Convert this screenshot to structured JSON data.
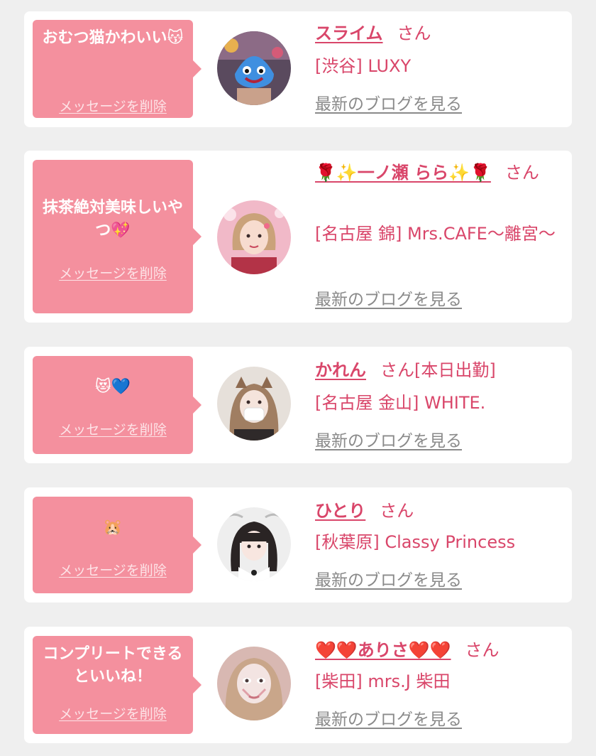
{
  "colors": {
    "page_bg": "#efefef",
    "card_bg": "#ffffff",
    "bubble_bg": "#f4909e",
    "accent_text": "#d9466a",
    "link_gray": "#8a8a8a"
  },
  "messages": [
    {
      "message": "おむつ猫かわいい😽",
      "delete_label": "メッセージを削除",
      "name": "スライム",
      "suffix": "さん",
      "shop": "[渋谷] LUXY",
      "blog_label": "最新のブログを見る"
    },
    {
      "message": "抹茶絶対美味しいやつ💖",
      "delete_label": "メッセージを削除",
      "name": "🌹✨一ノ瀬 らら✨🌹",
      "suffix": "さん",
      "shop": "[名古屋 錦] Mrs.CAFE〜離宮〜",
      "blog_label": "最新のブログを見る"
    },
    {
      "message": "😻💙",
      "delete_label": "メッセージを削除",
      "name": "かれん",
      "suffix": "さん[本日出勤]",
      "shop": "[名古屋 金山] WHITE.",
      "blog_label": "最新のブログを見る"
    },
    {
      "message": "🐹",
      "delete_label": "メッセージを削除",
      "name": "ひとり",
      "suffix": "さん",
      "shop": "[秋葉原] Classy Princess",
      "blog_label": "最新のブログを見る"
    },
    {
      "message": "コンプリートできるといいね！",
      "delete_label": "メッセージを削除",
      "name": "❤️❤️ありさ❤️❤️",
      "suffix": "さん",
      "shop": "[柴田] mrs.J 柴田",
      "blog_label": "最新のブログを見る"
    }
  ]
}
